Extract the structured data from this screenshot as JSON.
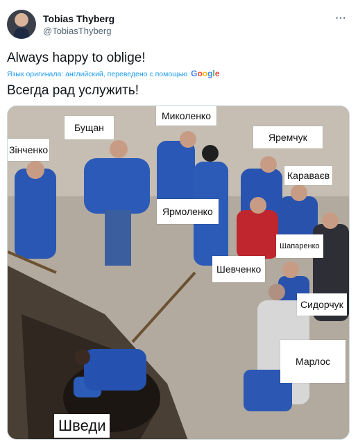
{
  "tweet": {
    "display_name": "Tobias Thyberg",
    "handle": "@TobiasThyberg",
    "more_icon": "⋯",
    "text": "Always happy to oblige!",
    "translation_note": "Язык оригинала: английский, переведено с помощью",
    "translation_provider": "Google",
    "translated_text": "Всегда рад услужить!"
  },
  "image_labels": {
    "mykolenko": "Миколенко",
    "bushchan": "Бущан",
    "zinchenko": "Зінченко",
    "yaremchuk": "Яремчук",
    "karavaev": "Караваєв",
    "yarmolenko": "Ярмоленко",
    "shaparenko": "Шапаренко",
    "shevchenko": "Шевченко",
    "sydorchuk": "Сидорчук",
    "marlos": "Марлос",
    "shvedy": "Шведи"
  },
  "colors": {
    "accent": "#1d9bf0",
    "text_primary": "#0f1419",
    "text_secondary": "#536471",
    "border": "#cfd9de"
  }
}
